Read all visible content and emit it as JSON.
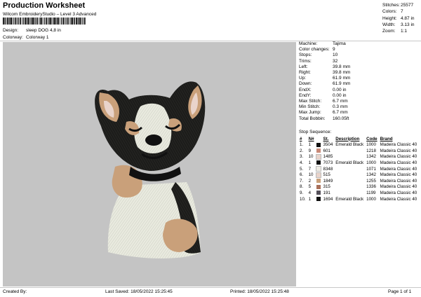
{
  "header": {
    "title": "Production Worksheet",
    "software": "Wilcom EmbroideryStudio – Level 3 Advanced",
    "design_label": "Design:",
    "design_value": "sleep DOG 4,8 in",
    "colorway_label": "Colorway:",
    "colorway_value": "Colorway 1"
  },
  "stats": [
    {
      "label": "Stitches:",
      "value": "25577"
    },
    {
      "label": "Colors:",
      "value": "7"
    },
    {
      "label": "Height:",
      "value": "4.87 in"
    },
    {
      "label": "Width:",
      "value": "3.13 in"
    },
    {
      "label": "Zoom:",
      "value": "1:1"
    }
  ],
  "machine_info": [
    {
      "label": "Machine:",
      "value": "Tajima"
    },
    {
      "label": "Color changes:",
      "value": "9"
    },
    {
      "label": "Stops:",
      "value": "10"
    },
    {
      "label": "Trims:",
      "value": "32"
    },
    {
      "label": "Left:",
      "value": "39.8 mm"
    },
    {
      "label": "Right:",
      "value": "39.8 mm"
    },
    {
      "label": "Up:",
      "value": "61.9 mm"
    },
    {
      "label": "Down:",
      "value": "61.9 mm"
    },
    {
      "label": "EndX:",
      "value": "0.00 in"
    },
    {
      "label": "EndY:",
      "value": "0.00 in"
    },
    {
      "label": "Max Stitch:",
      "value": "6.7 mm"
    },
    {
      "label": "Min Stitch:",
      "value": "0.3 mm"
    },
    {
      "label": "Max Jump:",
      "value": "6.7 mm"
    },
    {
      "label": "Total Bobbin:",
      "value": "160.05ft"
    }
  ],
  "stop_sequence": {
    "title": "Stop Sequence:",
    "headers": [
      "#",
      "N#",
      "St.",
      "Description",
      "Code",
      "Brand"
    ],
    "rows": [
      {
        "num": "1.",
        "n": "1",
        "color": "#111111",
        "st": "3504",
        "desc": "Emerald Black",
        "code": "1000",
        "brand": "Madeira Classic 40"
      },
      {
        "num": "2.",
        "n": "9",
        "color": "#c98a78",
        "st": "601",
        "desc": "",
        "code": "1218",
        "brand": "Madeira Classic 40"
      },
      {
        "num": "3.",
        "n": "10",
        "color": "#e9d4cb",
        "st": "1485",
        "desc": "",
        "code": "1342",
        "brand": "Madeira Classic 40"
      },
      {
        "num": "4.",
        "n": "1",
        "color": "#111111",
        "st": "7073",
        "desc": "Emerald Black",
        "code": "1000",
        "brand": "Madeira Classic 40"
      },
      {
        "num": "5.",
        "n": "7",
        "color": "#efece4",
        "st": "8348",
        "desc": "",
        "code": "1071",
        "brand": "Madeira Classic 40"
      },
      {
        "num": "6.",
        "n": "10",
        "color": "#e9d4cb",
        "st": "515",
        "desc": "",
        "code": "1342",
        "brand": "Madeira Classic 40"
      },
      {
        "num": "7.",
        "n": "2",
        "color": "#c9a07a",
        "st": "1849",
        "desc": "",
        "code": "1255",
        "brand": "Madeira Classic 40"
      },
      {
        "num": "8.",
        "n": "5",
        "color": "#a9705a",
        "st": "315",
        "desc": "",
        "code": "1336",
        "brand": "Madeira Classic 40"
      },
      {
        "num": "9.",
        "n": "4",
        "color": "#55505a",
        "st": "191",
        "desc": "",
        "code": "1199",
        "brand": "Madeira Classic 40"
      },
      {
        "num": "10.",
        "n": "1",
        "color": "#111111",
        "st": "1694",
        "desc": "Emerald Black",
        "code": "1000",
        "brand": "Madeira Classic 40"
      }
    ]
  },
  "footer": {
    "created_by": "Created By:",
    "last_saved": "Last Saved: 18/05/2022 15:25:45",
    "printed": "Printed: 18/05/2022 15:25:48",
    "page": "Page 1 of 1"
  },
  "colors": {
    "canvas_bg": "#c4c4c4"
  }
}
